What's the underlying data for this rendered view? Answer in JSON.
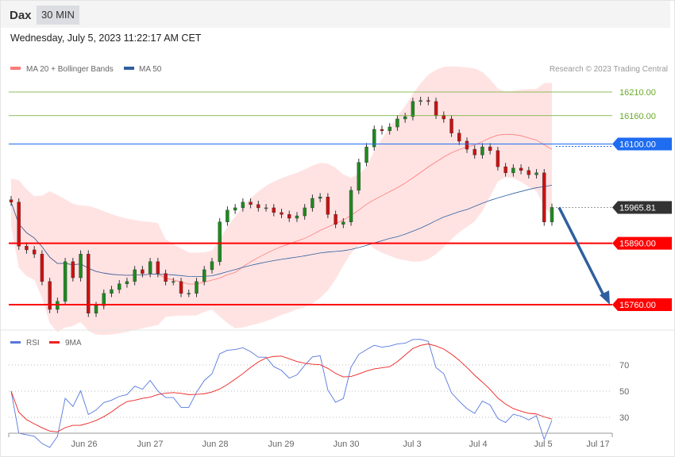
{
  "header": {
    "symbol": "Dax",
    "timeframe": "30 MIN",
    "datetime": "Wednesday, July 5, 2023 11:22:17 AM CET"
  },
  "legend": {
    "ma20": "MA 20 + Bollinger Bands",
    "ma50": "MA 50",
    "credit": "Research © 2023 Trading Central",
    "rsi": "RSI",
    "rsi_ma": "9MA"
  },
  "colors": {
    "ma20": "#ff7b7b",
    "ma50": "#2f5f9e",
    "support": "#ff0000",
    "resistance": "#6aaa2a",
    "pivot": "#1e6cf0",
    "last": "#333333",
    "rsi": "#5577dd",
    "rsi_ma": "#ee2222"
  },
  "chart_data": {
    "type": "candlestick",
    "ylim": [
      15740,
      16250
    ],
    "levels": [
      {
        "value": 16210,
        "label": "16210.00",
        "kind": "resistance"
      },
      {
        "value": 16160,
        "label": "16160.00",
        "kind": "resistance"
      },
      {
        "value": 16100,
        "label": "16100.00",
        "kind": "pivot"
      },
      {
        "value": 15965.81,
        "label": "15965.81",
        "kind": "last"
      },
      {
        "value": 15890,
        "label": "15890.00",
        "kind": "support"
      },
      {
        "value": 15760,
        "label": "15760.00",
        "kind": "support"
      }
    ],
    "closes": [
      15977,
      15884,
      15876,
      15867,
      15809,
      15750,
      15767,
      15851,
      15817,
      15867,
      15742,
      15758,
      15784,
      15792,
      15804,
      15809,
      15834,
      15826,
      15851,
      15826,
      15809,
      15809,
      15784,
      15784,
      15809,
      15834,
      15851,
      15935,
      15960,
      15965,
      15977,
      15972,
      15965,
      15965,
      15955,
      15951,
      15943,
      15948,
      15965,
      15985,
      15988,
      15951,
      15930,
      15935,
      16002,
      16061,
      16094,
      16131,
      16128,
      16136,
      16153,
      16158,
      16190,
      16192,
      16190,
      16161,
      16153,
      16123,
      16106,
      16089,
      16077,
      16094,
      16086,
      16052,
      16039,
      16049,
      16044,
      16035,
      16039,
      15935,
      15965.81
    ],
    "target": 15760,
    "x_ticks": [
      "Jun 26",
      "Jun 27",
      "Jun 28",
      "Jun 29",
      "Jun 30",
      "Jul 3",
      "Jul 4",
      "Jul 5",
      "Jul 17"
    ],
    "rsi_ticks": [
      "70",
      "50",
      "30"
    ]
  }
}
